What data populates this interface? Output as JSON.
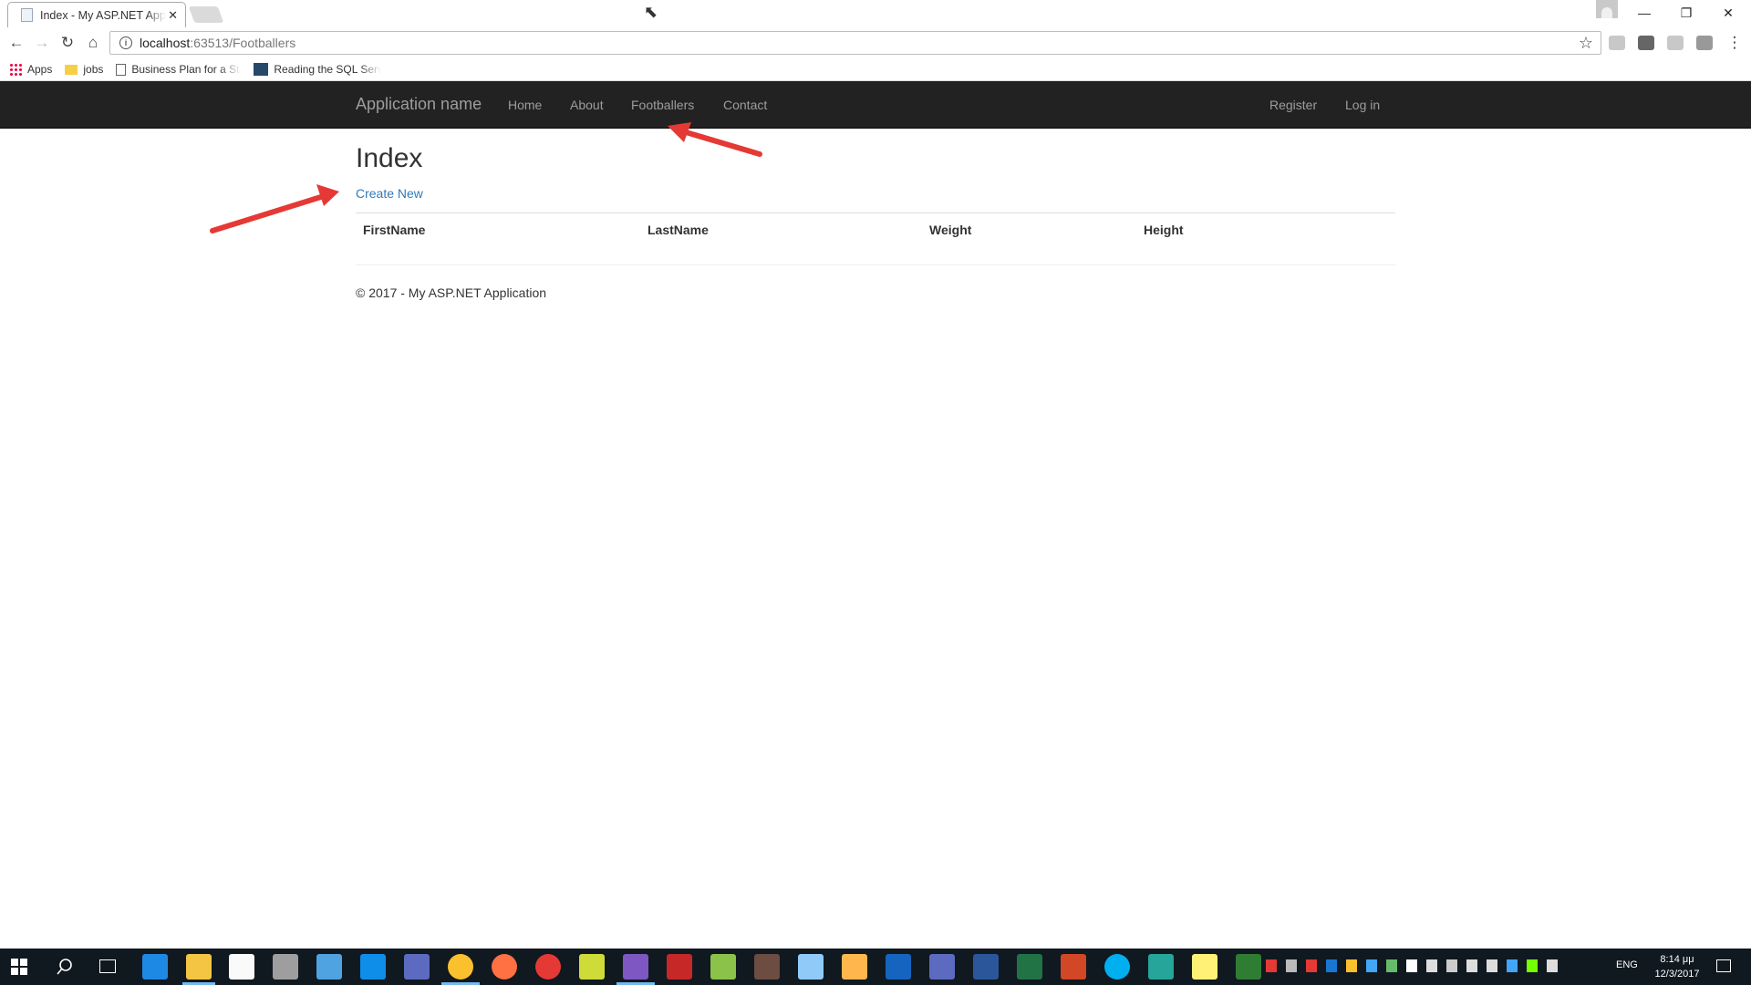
{
  "browser": {
    "tab_title": "Index - My ASP.NET Application",
    "tab_close": "✕",
    "url_host": "localhost",
    "url_rest": ":63513/Footballers",
    "window_controls": [
      "—",
      "❐",
      "✕"
    ],
    "bookmarks": [
      {
        "label": "Apps",
        "icon": "apps-icon"
      },
      {
        "label": "jobs",
        "icon": "folder-icon"
      },
      {
        "label": "Business Plan for a Sta",
        "icon": "page-icon"
      },
      {
        "label": "Reading the SQL Serv",
        "icon": "sql-icon"
      }
    ]
  },
  "navbar": {
    "brand": "Application name",
    "links": [
      "Home",
      "About",
      "Footballers",
      "Contact"
    ],
    "right_links": [
      "Register",
      "Log in"
    ]
  },
  "main": {
    "title": "Index",
    "create_link": "Create New",
    "table": {
      "columns": [
        "FirstName",
        "LastName",
        "Weight",
        "Height"
      ],
      "rows": []
    }
  },
  "footer": {
    "text": "© 2017 - My ASP.NET Application"
  },
  "taskbar": {
    "language": "ENG",
    "time": "8:14 μμ",
    "date": "12/3/2017"
  },
  "colors": {
    "navbar_bg": "#222222",
    "link": "#337ab7",
    "annotation_arrow": "#e53935",
    "taskbar_bg": "#101820"
  }
}
